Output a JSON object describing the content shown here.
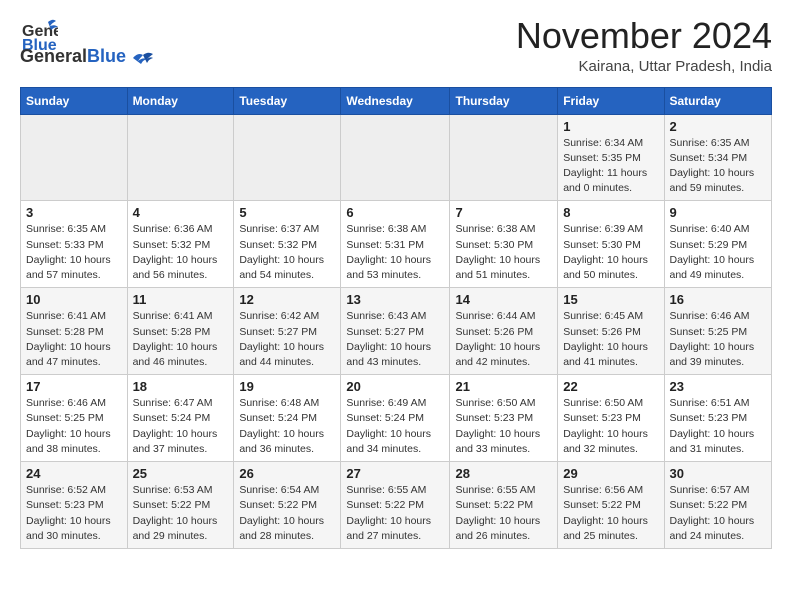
{
  "header": {
    "logo_general": "General",
    "logo_blue": "Blue",
    "month_title": "November 2024",
    "location": "Kairana, Uttar Pradesh, India"
  },
  "days_of_week": [
    "Sunday",
    "Monday",
    "Tuesday",
    "Wednesday",
    "Thursday",
    "Friday",
    "Saturday"
  ],
  "weeks": [
    [
      {
        "day": "",
        "info": ""
      },
      {
        "day": "",
        "info": ""
      },
      {
        "day": "",
        "info": ""
      },
      {
        "day": "",
        "info": ""
      },
      {
        "day": "",
        "info": ""
      },
      {
        "day": "1",
        "info": "Sunrise: 6:34 AM\nSunset: 5:35 PM\nDaylight: 11 hours and 0 minutes."
      },
      {
        "day": "2",
        "info": "Sunrise: 6:35 AM\nSunset: 5:34 PM\nDaylight: 10 hours and 59 minutes."
      }
    ],
    [
      {
        "day": "3",
        "info": "Sunrise: 6:35 AM\nSunset: 5:33 PM\nDaylight: 10 hours and 57 minutes."
      },
      {
        "day": "4",
        "info": "Sunrise: 6:36 AM\nSunset: 5:32 PM\nDaylight: 10 hours and 56 minutes."
      },
      {
        "day": "5",
        "info": "Sunrise: 6:37 AM\nSunset: 5:32 PM\nDaylight: 10 hours and 54 minutes."
      },
      {
        "day": "6",
        "info": "Sunrise: 6:38 AM\nSunset: 5:31 PM\nDaylight: 10 hours and 53 minutes."
      },
      {
        "day": "7",
        "info": "Sunrise: 6:38 AM\nSunset: 5:30 PM\nDaylight: 10 hours and 51 minutes."
      },
      {
        "day": "8",
        "info": "Sunrise: 6:39 AM\nSunset: 5:30 PM\nDaylight: 10 hours and 50 minutes."
      },
      {
        "day": "9",
        "info": "Sunrise: 6:40 AM\nSunset: 5:29 PM\nDaylight: 10 hours and 49 minutes."
      }
    ],
    [
      {
        "day": "10",
        "info": "Sunrise: 6:41 AM\nSunset: 5:28 PM\nDaylight: 10 hours and 47 minutes."
      },
      {
        "day": "11",
        "info": "Sunrise: 6:41 AM\nSunset: 5:28 PM\nDaylight: 10 hours and 46 minutes."
      },
      {
        "day": "12",
        "info": "Sunrise: 6:42 AM\nSunset: 5:27 PM\nDaylight: 10 hours and 44 minutes."
      },
      {
        "day": "13",
        "info": "Sunrise: 6:43 AM\nSunset: 5:27 PM\nDaylight: 10 hours and 43 minutes."
      },
      {
        "day": "14",
        "info": "Sunrise: 6:44 AM\nSunset: 5:26 PM\nDaylight: 10 hours and 42 minutes."
      },
      {
        "day": "15",
        "info": "Sunrise: 6:45 AM\nSunset: 5:26 PM\nDaylight: 10 hours and 41 minutes."
      },
      {
        "day": "16",
        "info": "Sunrise: 6:46 AM\nSunset: 5:25 PM\nDaylight: 10 hours and 39 minutes."
      }
    ],
    [
      {
        "day": "17",
        "info": "Sunrise: 6:46 AM\nSunset: 5:25 PM\nDaylight: 10 hours and 38 minutes."
      },
      {
        "day": "18",
        "info": "Sunrise: 6:47 AM\nSunset: 5:24 PM\nDaylight: 10 hours and 37 minutes."
      },
      {
        "day": "19",
        "info": "Sunrise: 6:48 AM\nSunset: 5:24 PM\nDaylight: 10 hours and 36 minutes."
      },
      {
        "day": "20",
        "info": "Sunrise: 6:49 AM\nSunset: 5:24 PM\nDaylight: 10 hours and 34 minutes."
      },
      {
        "day": "21",
        "info": "Sunrise: 6:50 AM\nSunset: 5:23 PM\nDaylight: 10 hours and 33 minutes."
      },
      {
        "day": "22",
        "info": "Sunrise: 6:50 AM\nSunset: 5:23 PM\nDaylight: 10 hours and 32 minutes."
      },
      {
        "day": "23",
        "info": "Sunrise: 6:51 AM\nSunset: 5:23 PM\nDaylight: 10 hours and 31 minutes."
      }
    ],
    [
      {
        "day": "24",
        "info": "Sunrise: 6:52 AM\nSunset: 5:23 PM\nDaylight: 10 hours and 30 minutes."
      },
      {
        "day": "25",
        "info": "Sunrise: 6:53 AM\nSunset: 5:22 PM\nDaylight: 10 hours and 29 minutes."
      },
      {
        "day": "26",
        "info": "Sunrise: 6:54 AM\nSunset: 5:22 PM\nDaylight: 10 hours and 28 minutes."
      },
      {
        "day": "27",
        "info": "Sunrise: 6:55 AM\nSunset: 5:22 PM\nDaylight: 10 hours and 27 minutes."
      },
      {
        "day": "28",
        "info": "Sunrise: 6:55 AM\nSunset: 5:22 PM\nDaylight: 10 hours and 26 minutes."
      },
      {
        "day": "29",
        "info": "Sunrise: 6:56 AM\nSunset: 5:22 PM\nDaylight: 10 hours and 25 minutes."
      },
      {
        "day": "30",
        "info": "Sunrise: 6:57 AM\nSunset: 5:22 PM\nDaylight: 10 hours and 24 minutes."
      }
    ]
  ]
}
